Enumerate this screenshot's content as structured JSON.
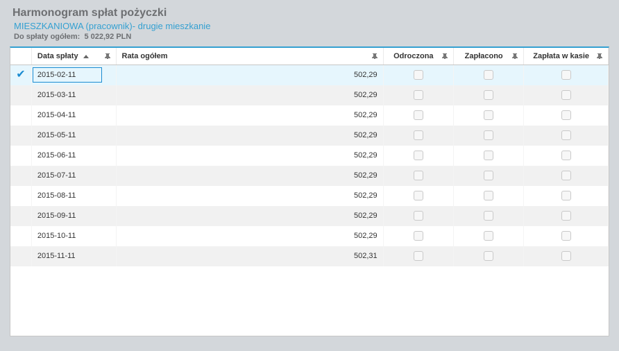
{
  "header": {
    "title": "Harmonogram spłat pożyczki",
    "subtitle": "MIESZKANIOWA (pracownik)- drugie mieszkanie",
    "summary_label": "Do spłaty ogółem:",
    "summary_value": "5 022,92 PLN"
  },
  "columns": {
    "date": "Data spłaty",
    "total": "Rata ogółem",
    "deferred": "Odroczona",
    "paid": "Zapłacono",
    "paid_cash": "Zapłata w kasie"
  },
  "rows": [
    {
      "date": "2015-02-11",
      "amount": "502,29",
      "deferred": false,
      "paid": false,
      "paid_cash": false,
      "selected": true
    },
    {
      "date": "2015-03-11",
      "amount": "502,29",
      "deferred": false,
      "paid": false,
      "paid_cash": false,
      "selected": false
    },
    {
      "date": "2015-04-11",
      "amount": "502,29",
      "deferred": false,
      "paid": false,
      "paid_cash": false,
      "selected": false
    },
    {
      "date": "2015-05-11",
      "amount": "502,29",
      "deferred": false,
      "paid": false,
      "paid_cash": false,
      "selected": false
    },
    {
      "date": "2015-06-11",
      "amount": "502,29",
      "deferred": false,
      "paid": false,
      "paid_cash": false,
      "selected": false
    },
    {
      "date": "2015-07-11",
      "amount": "502,29",
      "deferred": false,
      "paid": false,
      "paid_cash": false,
      "selected": false
    },
    {
      "date": "2015-08-11",
      "amount": "502,29",
      "deferred": false,
      "paid": false,
      "paid_cash": false,
      "selected": false
    },
    {
      "date": "2015-09-11",
      "amount": "502,29",
      "deferred": false,
      "paid": false,
      "paid_cash": false,
      "selected": false
    },
    {
      "date": "2015-10-11",
      "amount": "502,29",
      "deferred": false,
      "paid": false,
      "paid_cash": false,
      "selected": false
    },
    {
      "date": "2015-11-11",
      "amount": "502,31",
      "deferred": false,
      "paid": false,
      "paid_cash": false,
      "selected": false
    }
  ]
}
